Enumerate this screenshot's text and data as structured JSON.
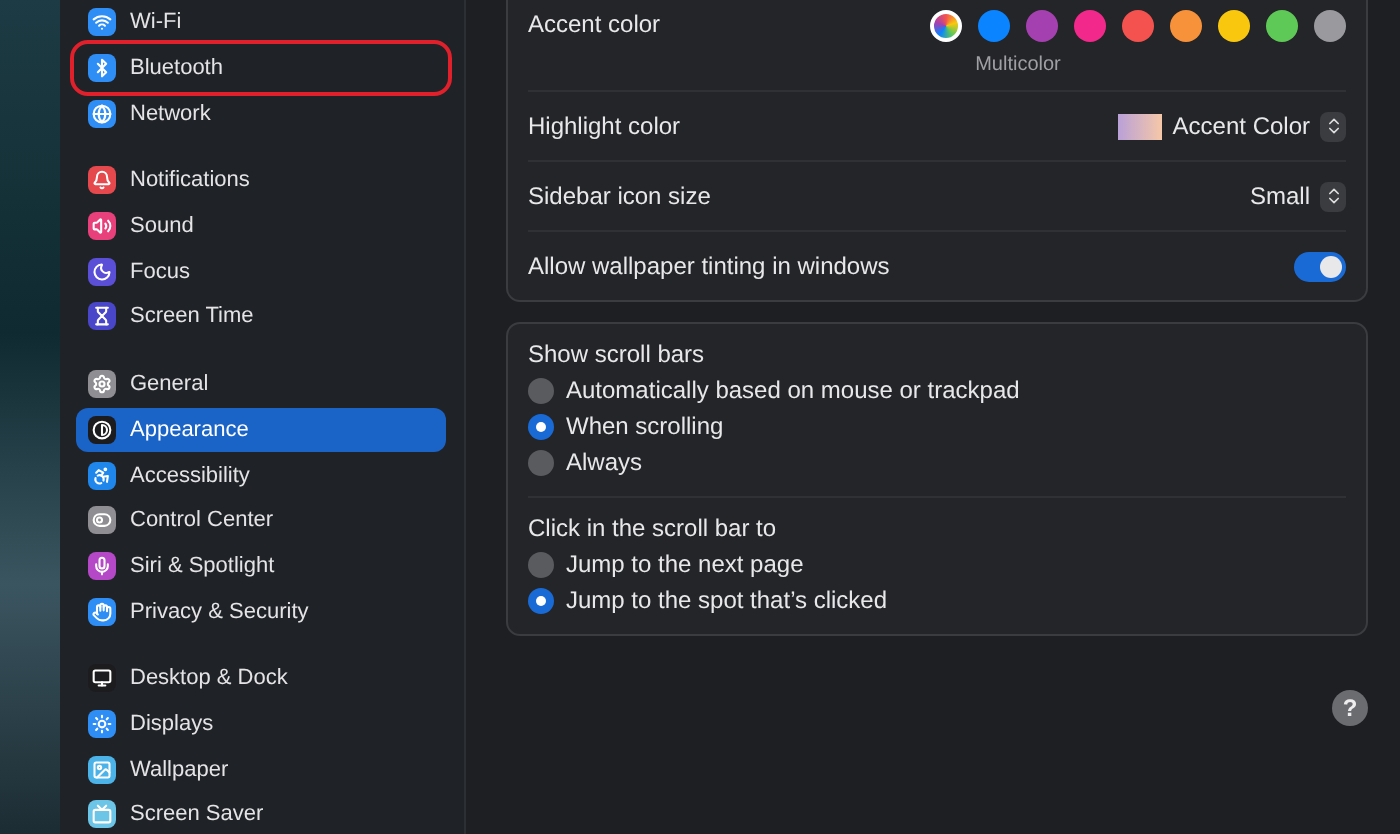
{
  "sidebar": {
    "groups": [
      {
        "items": [
          {
            "label": "Wi-Fi",
            "color": "#2f8ef5",
            "selected": false,
            "outlined": false
          },
          {
            "label": "Bluetooth",
            "color": "#2f8ef5",
            "selected": false,
            "outlined": true
          },
          {
            "label": "Network",
            "color": "#2f8ef5",
            "selected": false,
            "outlined": false
          }
        ]
      },
      {
        "items": [
          {
            "label": "Notifications",
            "color": "#e5484d",
            "selected": false,
            "outlined": false
          },
          {
            "label": "Sound",
            "color": "#e8407a",
            "selected": false,
            "outlined": false
          },
          {
            "label": "Focus",
            "color": "#5a4fd6",
            "selected": false,
            "outlined": false
          },
          {
            "label": "Screen Time",
            "color": "#4a46c9",
            "selected": false,
            "outlined": false
          }
        ]
      },
      {
        "items": [
          {
            "label": "General",
            "color": "#8e8e93",
            "selected": false,
            "outlined": false
          },
          {
            "label": "Appearance",
            "color": "#1c1c1e",
            "selected": true,
            "outlined": false
          },
          {
            "label": "Accessibility",
            "color": "#1f86ec",
            "selected": false,
            "outlined": false
          },
          {
            "label": "Control Center",
            "color": "#8e8e93",
            "selected": false,
            "outlined": false
          },
          {
            "label": "Siri & Spotlight",
            "color": "#b548c6",
            "selected": false,
            "outlined": false
          },
          {
            "label": "Privacy & Security",
            "color": "#2f8ef5",
            "selected": false,
            "outlined": false
          }
        ]
      },
      {
        "items": [
          {
            "label": "Desktop & Dock",
            "color": "#1c1c1e",
            "selected": false,
            "outlined": false
          },
          {
            "label": "Displays",
            "color": "#2f8ef5",
            "selected": false,
            "outlined": false
          },
          {
            "label": "Wallpaper",
            "color": "#4bb3e8",
            "selected": false,
            "outlined": false
          },
          {
            "label": "Screen Saver",
            "color": "#6cc4e6",
            "selected": false,
            "outlined": false
          }
        ]
      }
    ]
  },
  "appearance": {
    "accent": {
      "label": "Accent color",
      "caption": "Multicolor",
      "swatches": [
        {
          "kind": "multicolor",
          "color": "#ffffff",
          "selected": true
        },
        {
          "kind": "solid",
          "color": "#0a84ff",
          "selected": false
        },
        {
          "kind": "solid",
          "color": "#a540b0",
          "selected": false
        },
        {
          "kind": "solid",
          "color": "#f2288a",
          "selected": false
        },
        {
          "kind": "solid",
          "color": "#f4524f",
          "selected": false
        },
        {
          "kind": "solid",
          "color": "#f7913a",
          "selected": false
        },
        {
          "kind": "solid",
          "color": "#f9c80e",
          "selected": false
        },
        {
          "kind": "solid",
          "color": "#5fc957",
          "selected": false
        },
        {
          "kind": "solid",
          "color": "#9a9a9e",
          "selected": false
        }
      ]
    },
    "rows": [
      {
        "kind": "popup",
        "label": "Highlight color",
        "value": "Accent Color",
        "swatch": true
      },
      {
        "kind": "popup",
        "label": "Sidebar icon size",
        "value": "Small",
        "swatch": false
      },
      {
        "kind": "toggle",
        "label": "Allow wallpaper tinting in windows",
        "on": true
      }
    ]
  },
  "scroll": {
    "groups": [
      {
        "title": "Show scroll bars",
        "options": [
          {
            "label": "Automatically based on mouse or trackpad",
            "selected": false
          },
          {
            "label": "When scrolling",
            "selected": true
          },
          {
            "label": "Always",
            "selected": false
          }
        ]
      },
      {
        "title": "Click in the scroll bar to",
        "options": [
          {
            "label": "Jump to the next page",
            "selected": false
          },
          {
            "label": "Jump to the spot that’s clicked",
            "selected": true
          }
        ]
      }
    ]
  },
  "help": {
    "label": "?"
  }
}
